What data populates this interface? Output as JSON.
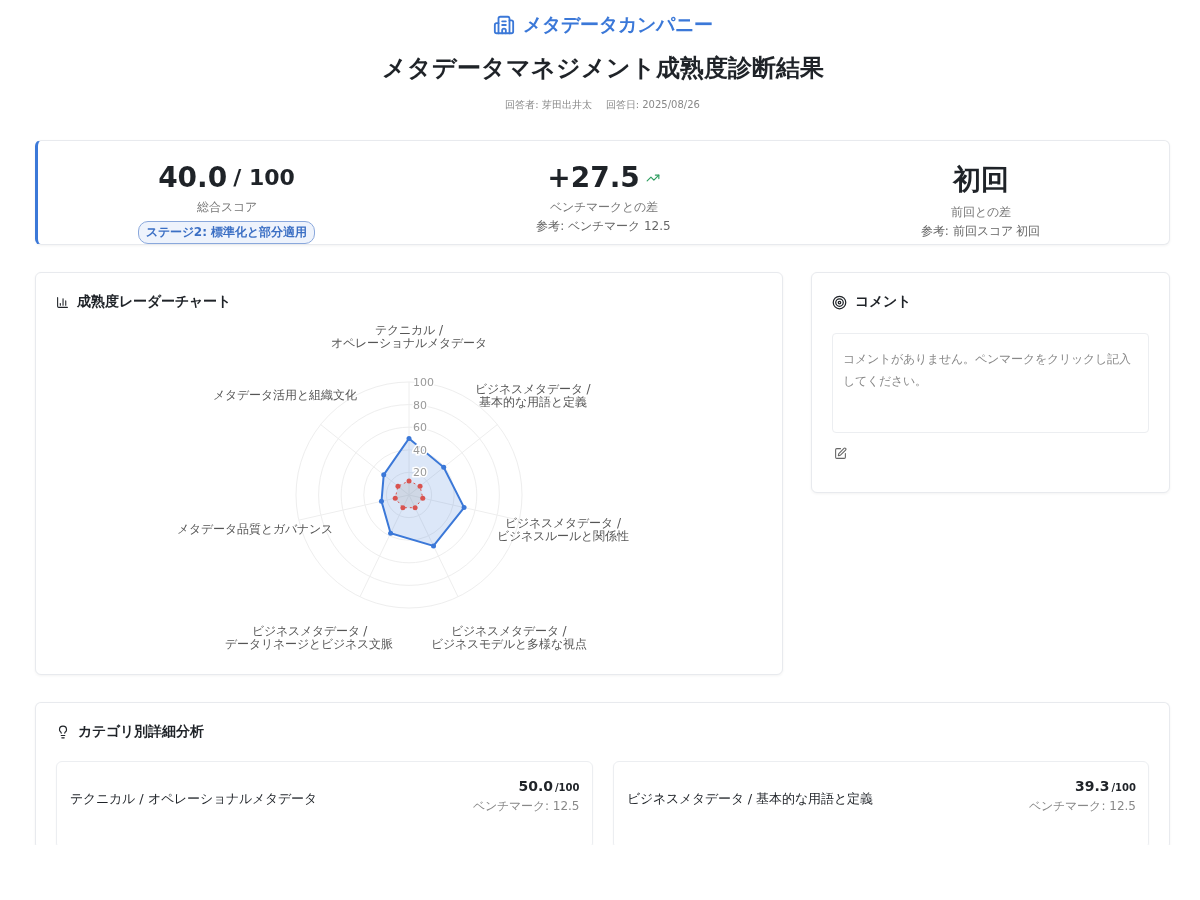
{
  "header": {
    "company": "メタデータカンパニー",
    "title": "メタデータマネジメント成熟度診断結果",
    "respondent": "回答者: 芽田出井太",
    "date": "回答日: 2025/08/26"
  },
  "summary": {
    "total": {
      "score": "40.0",
      "max": "/ 100",
      "label": "総合スコア",
      "stage": "ステージ2: 標準化と部分適用"
    },
    "benchmark": {
      "value": "+27.5",
      "label": "ベンチマークとの差",
      "note": "参考: ベンチマーク 12.5"
    },
    "previous": {
      "value": "初回",
      "label": "前回との差",
      "note": "参考: 前回スコア 初回"
    }
  },
  "radar": {
    "title": "成熟度レーダーチャート",
    "chart_data": {
      "type": "radar",
      "categories": [
        "テクニカル / オペレーショナルメタデータ",
        "ビジネスメタデータ / 基本的な用語と定義",
        "ビジネスメタデータ / ビジネスルールと関係性",
        "ビジネスメタデータ / ビジネスモデルと多様な視点",
        "ビジネスメタデータ / データリネージとビジネス文脈",
        "メタデータ品質とガバナンス",
        "メタデータ活用と組織文化"
      ],
      "ylim": [
        0,
        100
      ],
      "yticks": [
        20,
        40,
        60,
        80,
        100
      ],
      "series": [
        {
          "color": "#3b78d8",
          "values": [
            50,
            39.3,
            50,
            50,
            37.5,
            25,
            28.6
          ]
        },
        {
          "color": "#d9534f",
          "values": [
            12.5,
            12.5,
            12.5,
            12.5,
            12.5,
            12.5,
            12.5
          ]
        }
      ]
    }
  },
  "comment": {
    "title": "コメント",
    "message": "コメントがありません。ペンマークをクリックし記入してください。"
  },
  "categories": {
    "title": "カテゴリ別詳細分析",
    "items": [
      {
        "name": "テクニカル / オペレーショナルメタデータ",
        "score": "50.0",
        "max": "/100",
        "benchmark": "ベンチマーク: 12.5"
      },
      {
        "name": "ビジネスメタデータ / 基本的な用語と定義",
        "score": "39.3",
        "max": "/100",
        "benchmark": "ベンチマーク: 12.5"
      }
    ]
  }
}
